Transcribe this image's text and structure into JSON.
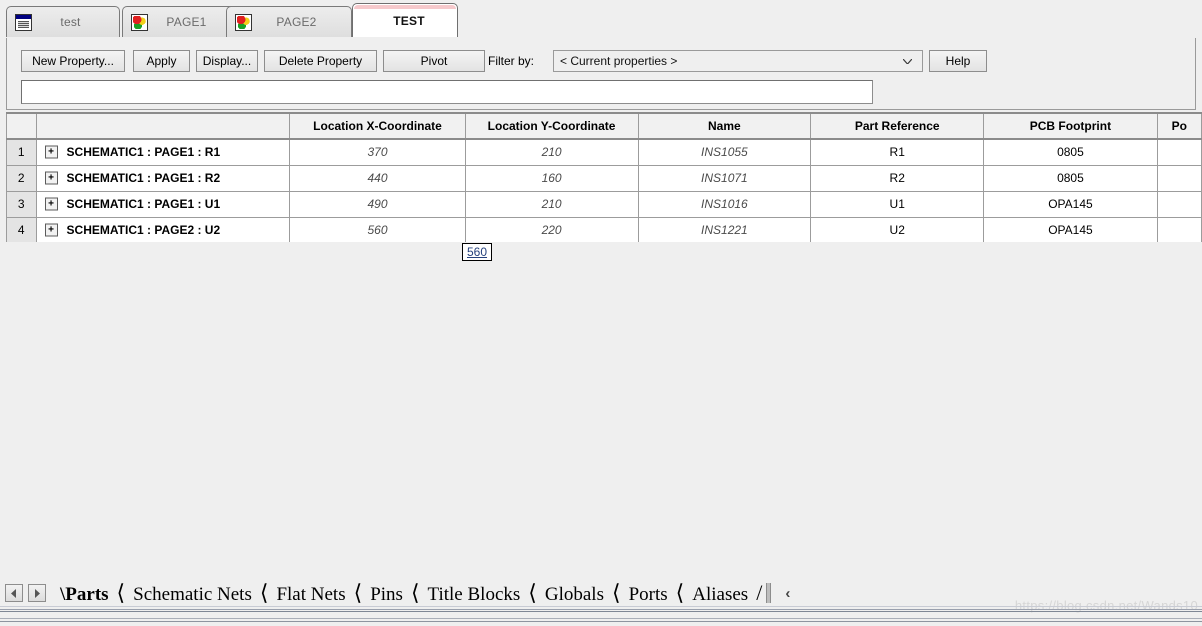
{
  "window": {
    "tabs": [
      {
        "label": "test",
        "icon": "project-window-icon",
        "active": false
      },
      {
        "label": "PAGE1",
        "icon": "schematic-page-icon",
        "active": false
      },
      {
        "label": "PAGE2",
        "icon": "schematic-page-icon",
        "active": false
      },
      {
        "label": "TEST",
        "icon": "none",
        "active": true
      }
    ]
  },
  "toolbar": {
    "new_property_label": "New Property...",
    "apply_label": "Apply",
    "display_label": "Display...",
    "delete_property_label": "Delete Property",
    "pivot_label": "Pivot",
    "filter_label": "Filter by:",
    "filter_value": "< Current properties >",
    "help_label": "Help",
    "search_value": "",
    "search_placeholder": ""
  },
  "grid": {
    "columns": [
      "",
      "Location X-Coordinate",
      "Location Y-Coordinate",
      "Name",
      "Part Reference",
      "PCB Footprint",
      "Po"
    ],
    "rows": [
      {
        "number": "1",
        "expander": "+",
        "name": "SCHEMATIC1 : PAGE1 : R1",
        "location_x": "370",
        "location_y": "210",
        "inst_name": "INS1055",
        "part_reference": "R1",
        "pcb_footprint": "0805",
        "po": ""
      },
      {
        "number": "2",
        "expander": "+",
        "name": "SCHEMATIC1 : PAGE1 : R2",
        "location_x": "440",
        "location_y": "160",
        "inst_name": "INS1071",
        "part_reference": "R2",
        "pcb_footprint": "0805",
        "po": ""
      },
      {
        "number": "3",
        "expander": "+",
        "name": "SCHEMATIC1 : PAGE1 : U1",
        "location_x": "490",
        "location_y": "210",
        "inst_name": "INS1016",
        "part_reference": "U1",
        "pcb_footprint": "OPA145",
        "po": ""
      },
      {
        "number": "4",
        "expander": "+",
        "name": "SCHEMATIC1 : PAGE2 : U2",
        "location_x": "560",
        "location_y": "220",
        "inst_name": "INS1221",
        "part_reference": "U2",
        "pcb_footprint": "OPA145",
        "po": ""
      }
    ]
  },
  "tooltip": {
    "value": "560"
  },
  "sheet_tabs": {
    "prev_label": "◄",
    "next_label": "►",
    "items": [
      {
        "label": "Parts",
        "active": true
      },
      {
        "label": "Schematic Nets",
        "active": false
      },
      {
        "label": "Flat Nets",
        "active": false
      },
      {
        "label": "Pins",
        "active": false
      },
      {
        "label": "Title Blocks",
        "active": false
      },
      {
        "label": "Globals",
        "active": false
      },
      {
        "label": "Ports",
        "active": false
      },
      {
        "label": "Aliases",
        "active": false
      }
    ],
    "overflow_label": "‹"
  },
  "watermark": {
    "text": "https://blog.csdn.net/Wands10"
  },
  "colors": {
    "window_bg": "#efefef",
    "active_tab_accent": "#f6c9cc",
    "grid_line": "#9c9c9c",
    "header_bg": "#f1f1f1",
    "italic_value": "#4b4b4b",
    "tooltip_text": "#26427e"
  }
}
